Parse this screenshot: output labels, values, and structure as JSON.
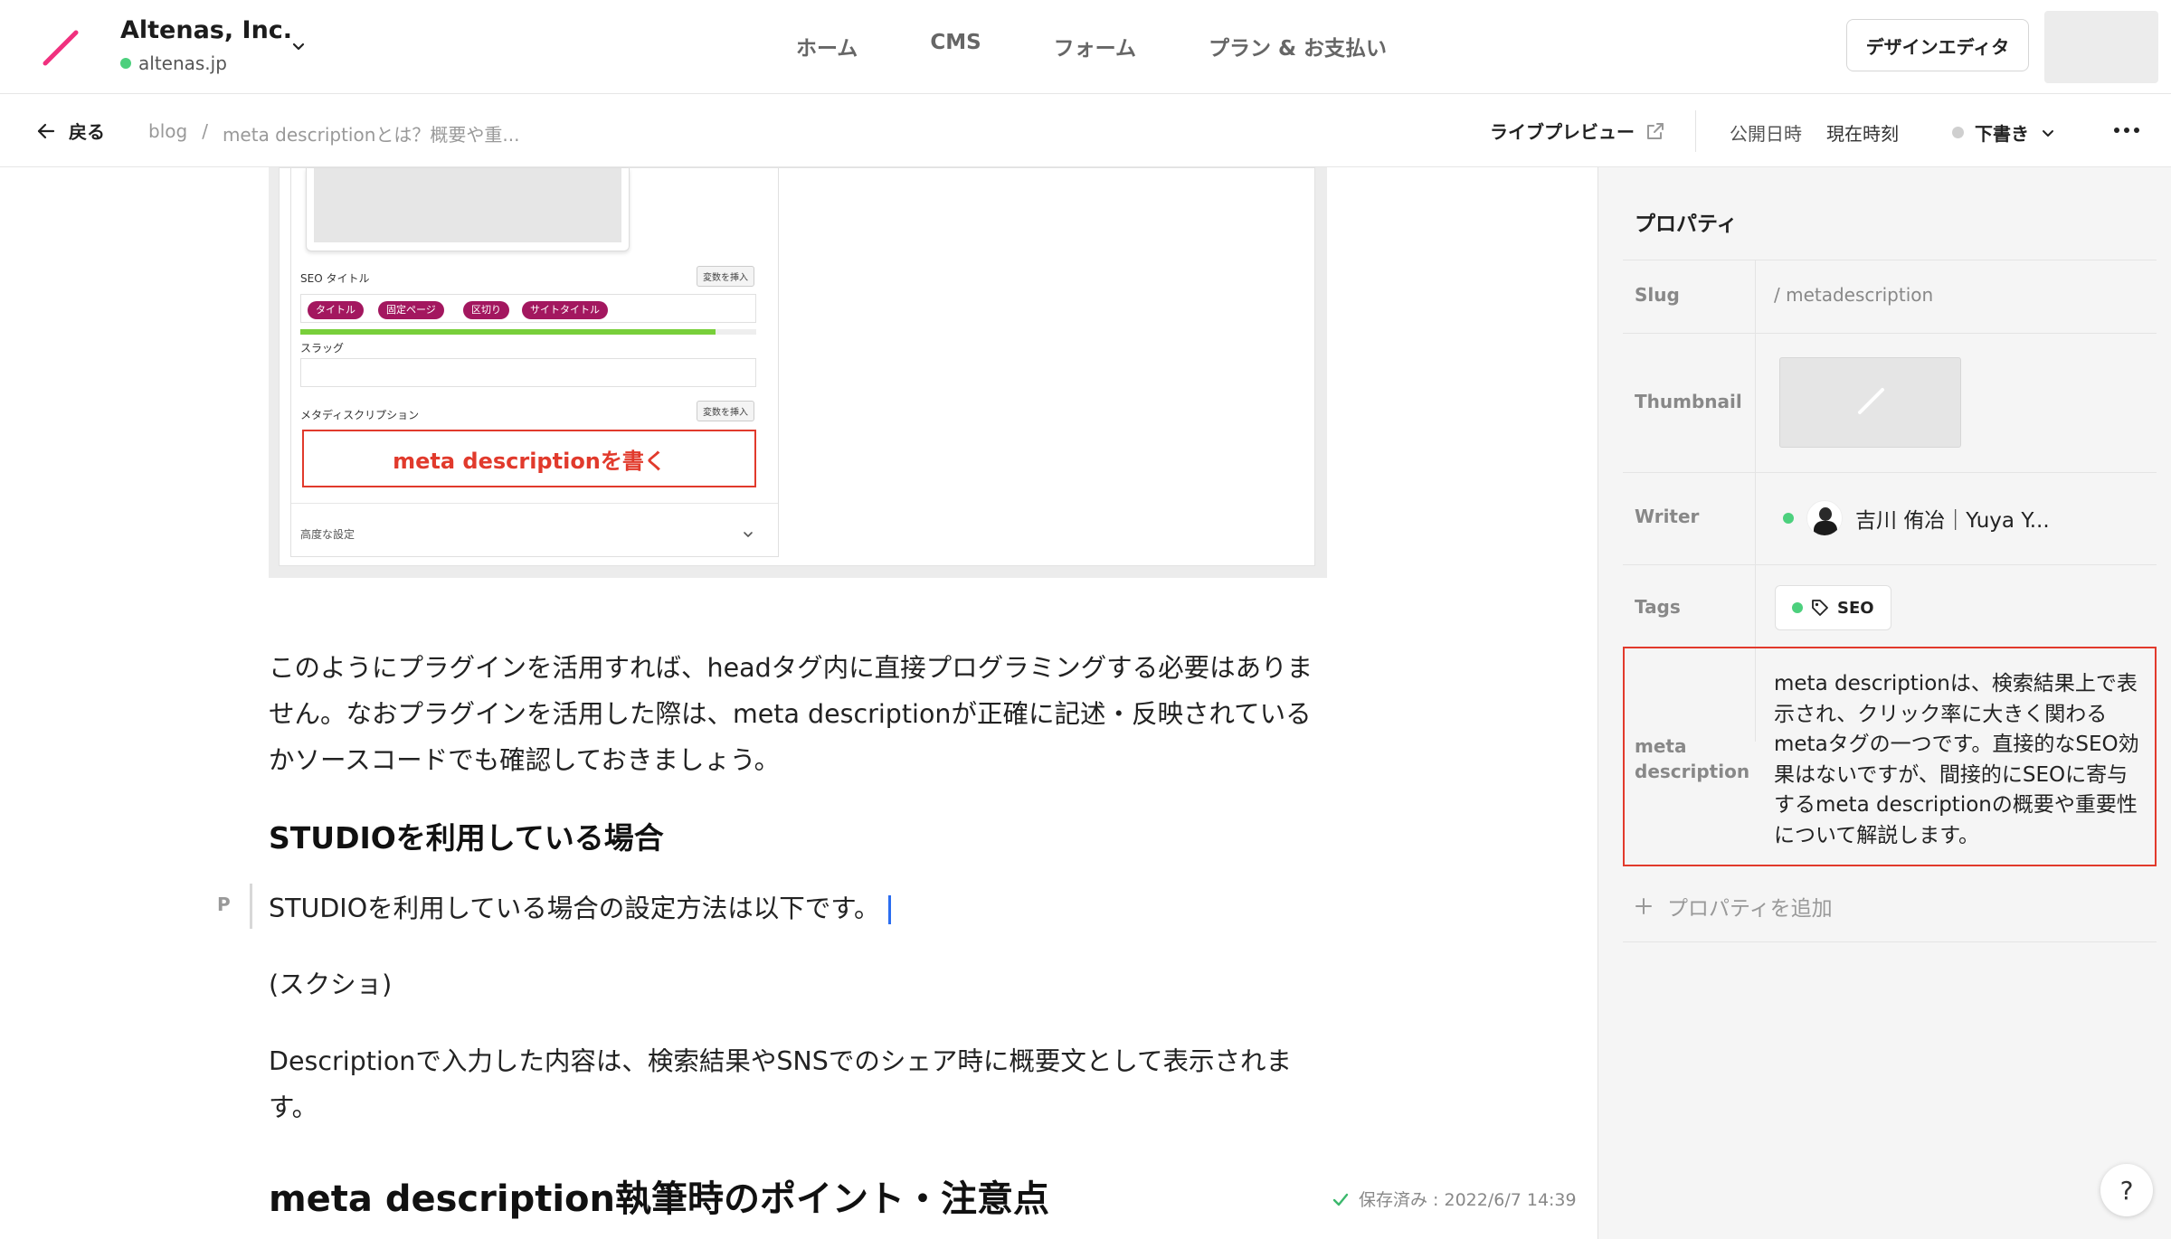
{
  "header": {
    "org_name": "Altenas, Inc.",
    "org_domain": "altenas.jp",
    "nav": [
      "ホーム",
      "CMS",
      "フォーム",
      "プラン & お支払い"
    ],
    "design_editor": "デザインエディタ"
  },
  "subbar": {
    "back": "戻る",
    "crumb_root": "blog",
    "crumb_sep": "/",
    "crumb_current": "meta descriptionとは？概要や重...",
    "live_preview": "ライブプレビュー",
    "publish_label": "公開日時",
    "publish_value": "現在時刻",
    "status": "下書き"
  },
  "screenshot": {
    "seo_title_label": "SEO タイトル",
    "insert_var": "変数を挿入",
    "pills": [
      "タイトル",
      "固定ページ",
      "区切り",
      "サイトタイトル"
    ],
    "seo_progress": 0.91,
    "slug_label": "スラッグ",
    "meta_desc_label": "メタディスクリプション",
    "callout": "meta descriptionを書く",
    "advanced": "高度な設定"
  },
  "article": {
    "para1": "このようにプラグインを活用すれば、headタグ内に直接プログラミングする必要はありません。なおプラグインを活用した際は、meta descriptionが正確に記述・反映されているかソースコードでも確認しておきましょう。",
    "heading_studio": "STUDIOを利用している場合",
    "block_marker": "P",
    "para_studio": "STUDIOを利用している場合の設定方法は以下です。",
    "para_screenshot": "(スクショ)",
    "para_description": "Descriptionで入力した内容は、検索結果やSNSでのシェア時に概要文として表示されます。",
    "heading_points": "meta description執筆時のポイント・注意点",
    "saved": "保存済み : 2022/6/7 14:39"
  },
  "properties": {
    "title": "プロパティ",
    "slug_label": "Slug",
    "slug_value": "/ metadescription",
    "thumbnail_label": "Thumbnail",
    "writer_label": "Writer",
    "writer_name": "吉川 侑冶｜Yuya Y...",
    "tags_label": "Tags",
    "tag": "SEO",
    "meta_label": "meta description",
    "meta_value": "meta descriptionは、検索結果上で表示され、クリック率に大きく関わるmetaタグの一つです。直接的なSEO効果はないですが、間接的にSEOに寄与するmeta descriptionの概要や重要性について解説します。",
    "add_property": "プロパティを追加"
  },
  "help": "?",
  "colors": {
    "accent_pink": "#f0307e",
    "highlight_red": "#e23a2c",
    "status_green": "#4cd07d",
    "caret_blue": "#2b6df0",
    "pill_magenta": "#a3175f"
  }
}
